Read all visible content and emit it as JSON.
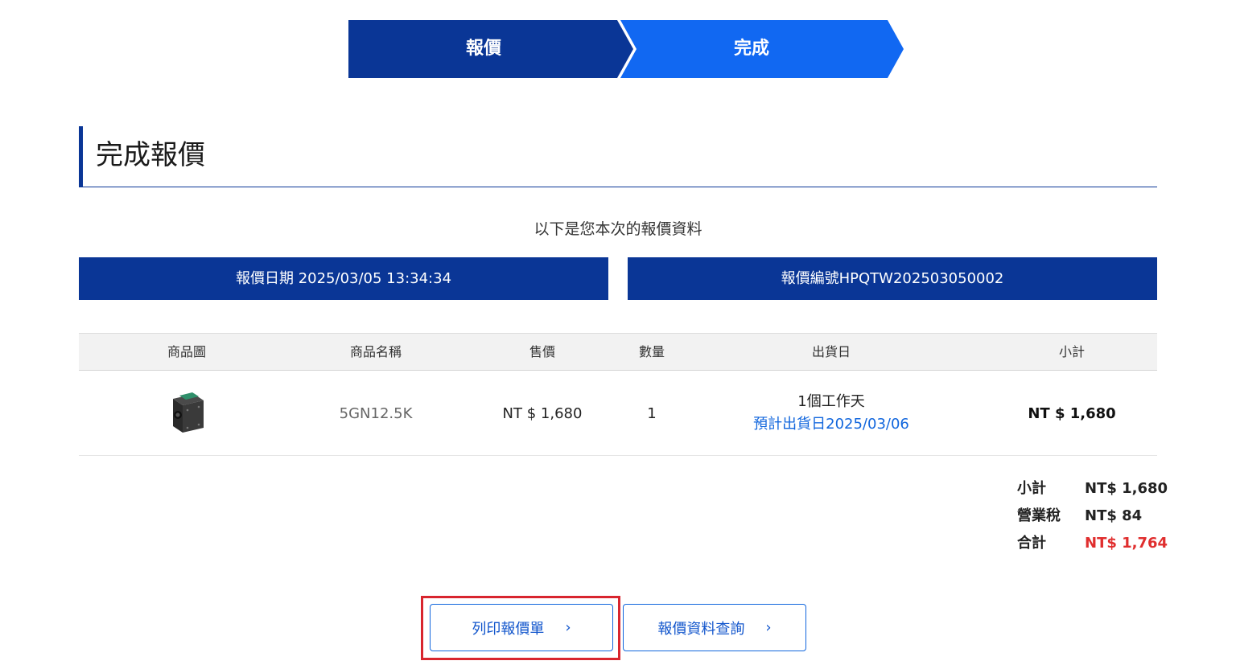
{
  "steps": [
    {
      "label": "報價",
      "color": "#0a3696"
    },
    {
      "label": "完成",
      "color": "#1168f2"
    }
  ],
  "page_title": "完成報價",
  "intro": "以下是您本次的報價資料",
  "quote_date": "報價日期 2025/03/05 13:34:34",
  "quote_number": "報價編號HPQTW202503050002",
  "table": {
    "headers": [
      "商品圖",
      "商品名稱",
      "售價",
      "數量",
      "出貨日",
      "小計"
    ],
    "rows": [
      {
        "image_icon": "gear-motor-icon",
        "name": "5GN12.5K",
        "price": "NT $ 1,680",
        "qty": "1",
        "ship_days": "1個工作天",
        "ship_date": "預計出貨日2025/03/06",
        "subtotal": "NT $ 1,680"
      }
    ]
  },
  "summary": {
    "subtotal_label": "小計",
    "subtotal_value": "NT$ 1,680",
    "tax_label": "營業稅",
    "tax_value": "NT$ 84",
    "total_label": "合計",
    "total_value": "NT$ 1,764"
  },
  "buttons": {
    "print_label": "列印報價單",
    "query_label": "報價資料查詢",
    "chevron": "›"
  },
  "colors": {
    "primary": "#0a3696",
    "accent": "#1168f2",
    "highlight": "#d8252e",
    "total": "#e02e2e"
  }
}
